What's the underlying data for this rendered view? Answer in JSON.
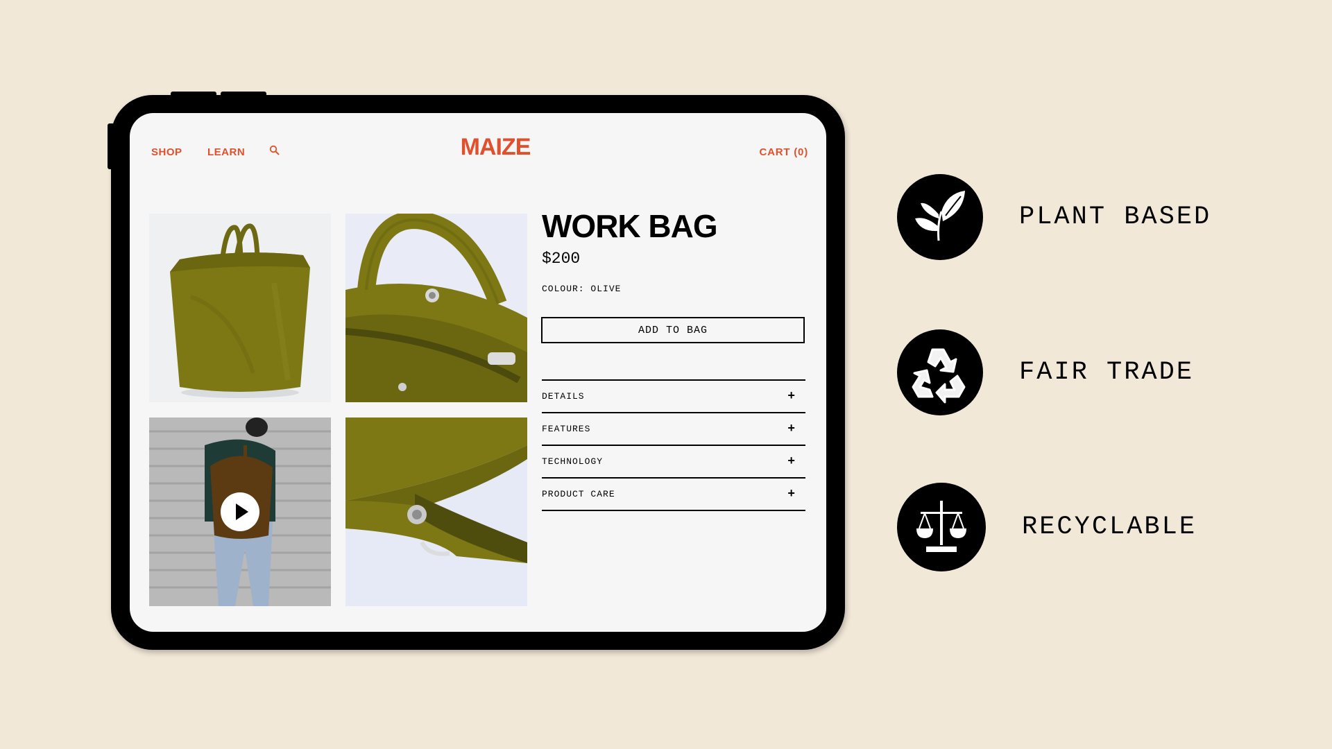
{
  "nav": {
    "shop": "SHOP",
    "learn": "LEARN",
    "search_icon": "search-icon",
    "logo": "MAIZE",
    "cart": "CART (0)"
  },
  "product": {
    "title": "WORK BAG",
    "price": "$200",
    "colour": "COLOUR: OLIVE",
    "add_to_bag": "ADD TO BAG",
    "accordion": [
      {
        "label": "DETAILS",
        "icon": "plus-icon"
      },
      {
        "label": "FEATURES",
        "icon": "plus-icon"
      },
      {
        "label": "TECHNOLOGY",
        "icon": "plus-icon"
      },
      {
        "label": "PRODUCT CARE",
        "icon": "plus-icon"
      }
    ],
    "images": [
      {
        "name": "bag-front-photo"
      },
      {
        "name": "bag-top-detail-photo"
      },
      {
        "name": "bag-video-thumbnail",
        "overlay": "play-icon"
      },
      {
        "name": "bag-strap-detail-photo"
      }
    ]
  },
  "features": [
    {
      "label": "PLANT BASED",
      "icon": "leaf-icon"
    },
    {
      "label": "FAIR TRADE",
      "icon": "recycle-icon"
    },
    {
      "label": "RECYCLABLE",
      "icon": "scale-icon"
    }
  ],
  "colors": {
    "brand": "#e2502b",
    "olive": "#7d7814",
    "background": "#f2e8d8",
    "screen": "#f6f6f6"
  }
}
